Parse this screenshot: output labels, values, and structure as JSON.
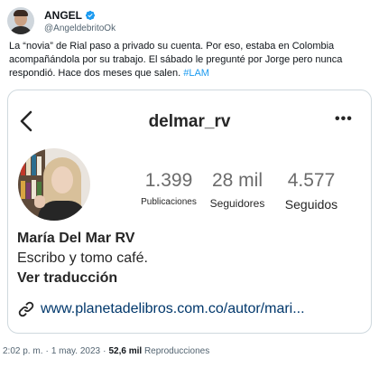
{
  "author": {
    "display_name": "ANGEL",
    "handle": "@AngeldebritoOk",
    "verified_color": "#1d9bf0"
  },
  "tweet": {
    "text": "La “novia” de Rial paso a privado su cuenta. Por eso, estaba en Colombia acompañándola por su trabajo. El sábado le pregunté por Jorge pero nunca respondió. Hace dos meses que salen. ",
    "hashtag": "#LAM"
  },
  "instagram": {
    "username": "delmar_rv",
    "more_icon": "•••",
    "stats": [
      {
        "value": "1.399",
        "label": "Publicaciones"
      },
      {
        "value": "28 mil",
        "label": "Seguidores"
      },
      {
        "value": "4.577",
        "label": "Seguidos"
      }
    ],
    "bio": {
      "name": "María Del Mar RV",
      "line": "Escribo y tomo café.",
      "translate": "Ver traducción"
    },
    "link": "www.planetadelibros.com.co/autor/mari..."
  },
  "footer": {
    "time": "2:02 p. m.",
    "separator": "·",
    "date": "1 may. 2023",
    "views_count": "52,6 mil",
    "views_label": "Reproducciones"
  }
}
